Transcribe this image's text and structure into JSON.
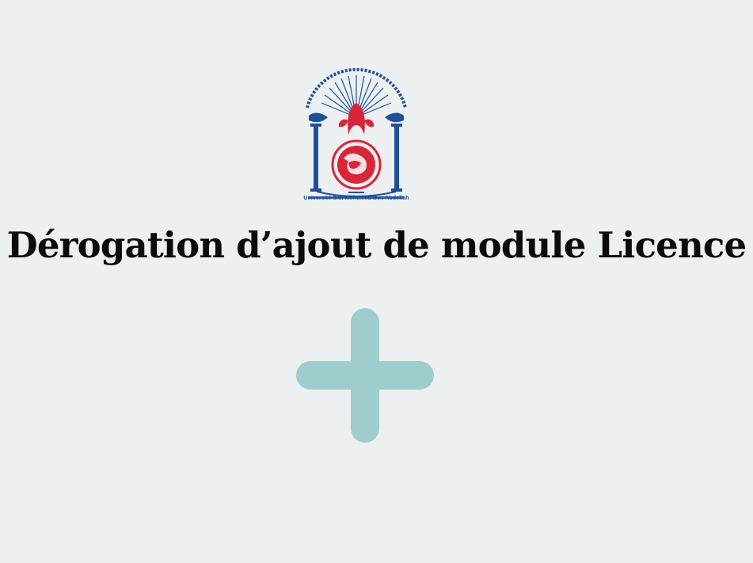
{
  "header": {
    "logo_icon": "university-emblem-icon",
    "logo_caption": "Université Sidi Mohamed Ben Abdellah",
    "logo_arabic_text": "جامعة سيدي محمد بن عبد الله",
    "logo_tifinagh_text": "ⵜⴰⵙⴷⴰⵡⵉⵜ ⵙⵉⴷⵉ ⵎⵓⵃⵎⵎⴷ ⴱⵏ ⵄⴱⴷⵍⵍⴰⵀ"
  },
  "main": {
    "title": "Dérogation d’ajout de module Licence",
    "add_icon": "plus-icon"
  },
  "colors": {
    "background": "#edf0f1",
    "plus": "#9fcdcd",
    "logo_blue": "#1f4f9a",
    "logo_red": "#d9253a"
  }
}
